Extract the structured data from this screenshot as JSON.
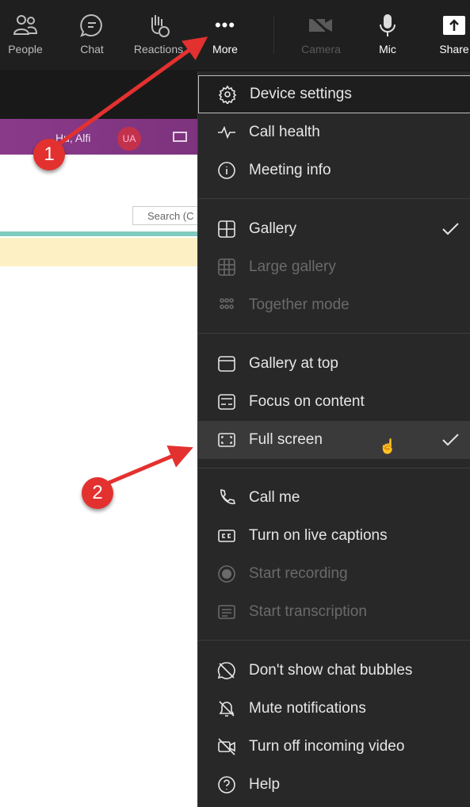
{
  "toolbar": {
    "people": "People",
    "chat": "Chat",
    "reactions": "Reactions",
    "more": "More",
    "camera": "Camera",
    "mic": "Mic",
    "share": "Share"
  },
  "background": {
    "user_name": "Hu, Alfi",
    "avatar": "UA",
    "search_placeholder": "Search (C"
  },
  "menu": {
    "items": [
      {
        "label": "Device settings",
        "icon": "gear-icon"
      },
      {
        "label": "Call health",
        "icon": "pulse-icon"
      },
      {
        "label": "Meeting info",
        "icon": "info-icon"
      },
      {
        "label": "Gallery",
        "icon": "gallery-icon",
        "checked": true
      },
      {
        "label": "Large gallery",
        "icon": "large-gallery-icon",
        "disabled": true
      },
      {
        "label": "Together mode",
        "icon": "together-mode-icon",
        "disabled": true
      },
      {
        "label": "Gallery at top",
        "icon": "gallery-top-icon"
      },
      {
        "label": "Focus on content",
        "icon": "focus-icon"
      },
      {
        "label": "Full screen",
        "icon": "fullscreen-icon",
        "checked": true,
        "highlighted": true
      },
      {
        "label": "Call me",
        "icon": "phone-icon"
      },
      {
        "label": "Turn on live captions",
        "icon": "cc-icon"
      },
      {
        "label": "Start recording",
        "icon": "record-icon",
        "disabled": true
      },
      {
        "label": "Start transcription",
        "icon": "transcript-icon",
        "disabled": true
      },
      {
        "label": "Don't show chat bubbles",
        "icon": "chat-off-icon"
      },
      {
        "label": "Mute notifications",
        "icon": "bell-off-icon"
      },
      {
        "label": "Turn off incoming video",
        "icon": "video-off-icon"
      },
      {
        "label": "Help",
        "icon": "help-icon"
      }
    ]
  },
  "annotations": {
    "step1": "1",
    "step2": "2",
    "arrow_color": "#e3312f"
  }
}
